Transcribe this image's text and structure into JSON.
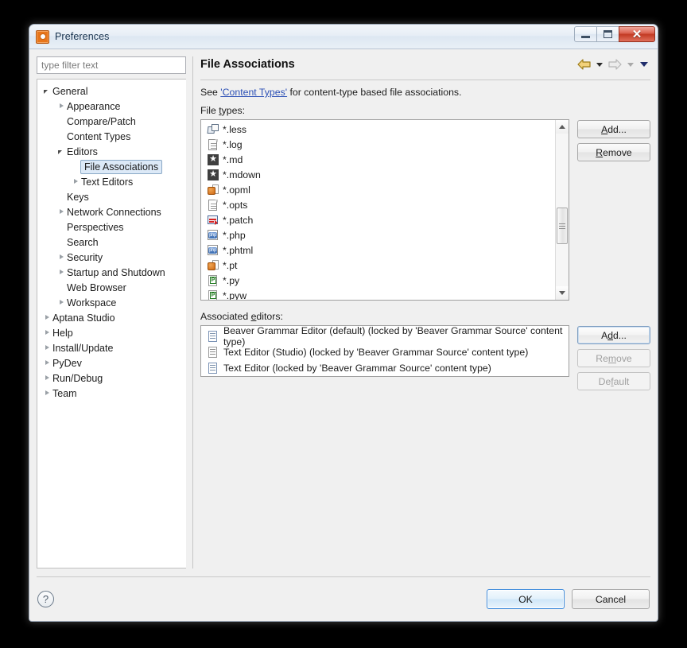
{
  "window": {
    "title": "Preferences",
    "icon": "gear-icon",
    "controls": {
      "minimize": "minimize-button",
      "maximize": "maximize-button",
      "close": "✕"
    }
  },
  "sidebar": {
    "filter": {
      "placeholder": "type filter text",
      "value": ""
    },
    "items": [
      {
        "label": "General",
        "indent": 0,
        "arrow": "expanded",
        "selected": false
      },
      {
        "label": "Appearance",
        "indent": 1,
        "arrow": "collapsed",
        "selected": false
      },
      {
        "label": "Compare/Patch",
        "indent": 1,
        "arrow": "none",
        "selected": false
      },
      {
        "label": "Content Types",
        "indent": 1,
        "arrow": "none",
        "selected": false
      },
      {
        "label": "Editors",
        "indent": 1,
        "arrow": "expanded",
        "selected": false
      },
      {
        "label": "File Associations",
        "indent": 2,
        "arrow": "none",
        "selected": true
      },
      {
        "label": "Text Editors",
        "indent": 2,
        "arrow": "collapsed",
        "selected": false
      },
      {
        "label": "Keys",
        "indent": 1,
        "arrow": "none",
        "selected": false
      },
      {
        "label": "Network Connections",
        "indent": 1,
        "arrow": "collapsed",
        "selected": false
      },
      {
        "label": "Perspectives",
        "indent": 1,
        "arrow": "none",
        "selected": false
      },
      {
        "label": "Search",
        "indent": 1,
        "arrow": "none",
        "selected": false
      },
      {
        "label": "Security",
        "indent": 1,
        "arrow": "collapsed",
        "selected": false
      },
      {
        "label": "Startup and Shutdown",
        "indent": 1,
        "arrow": "collapsed",
        "selected": false
      },
      {
        "label": "Web Browser",
        "indent": 1,
        "arrow": "none",
        "selected": false
      },
      {
        "label": "Workspace",
        "indent": 1,
        "arrow": "collapsed",
        "selected": false
      },
      {
        "label": "Aptana Studio",
        "indent": 0,
        "arrow": "collapsed",
        "selected": false
      },
      {
        "label": "Help",
        "indent": 0,
        "arrow": "collapsed",
        "selected": false
      },
      {
        "label": "Install/Update",
        "indent": 0,
        "arrow": "collapsed",
        "selected": false
      },
      {
        "label": "PyDev",
        "indent": 0,
        "arrow": "collapsed",
        "selected": false
      },
      {
        "label": "Run/Debug",
        "indent": 0,
        "arrow": "collapsed",
        "selected": false
      },
      {
        "label": "Team",
        "indent": 0,
        "arrow": "collapsed",
        "selected": false
      }
    ]
  },
  "page": {
    "title": "File Associations",
    "nav": {
      "back_icon": "back-arrow-icon",
      "back_menu_icon": "chevron-down-icon",
      "forward_icon": "forward-arrow-icon",
      "forward_menu_icon": "chevron-down-icon",
      "menu_icon": "chevron-down-icon"
    },
    "hint_prefix": "See ",
    "hint_link": "'Content Types'",
    "hint_suffix": " for content-type based file associations.",
    "file_types_label": "File types:",
    "associated_editors_label": "Associated editors:"
  },
  "file_types": {
    "items": [
      {
        "name": "*.less",
        "icon": "less-file-icon"
      },
      {
        "name": "*.log",
        "icon": "text-file-icon"
      },
      {
        "name": "*.md",
        "icon": "markdown-star-icon"
      },
      {
        "name": "*.mdown",
        "icon": "markdown-star-icon"
      },
      {
        "name": "*.opml",
        "icon": "opml-file-icon"
      },
      {
        "name": "*.opts",
        "icon": "text-file-icon"
      },
      {
        "name": "*.patch",
        "icon": "patch-file-icon"
      },
      {
        "name": "*.php",
        "icon": "php-file-icon"
      },
      {
        "name": "*.phtml",
        "icon": "php-file-icon"
      },
      {
        "name": "*.pt",
        "icon": "opml-file-icon"
      },
      {
        "name": "*.py",
        "icon": "python-file-icon"
      },
      {
        "name": "*.pyw",
        "icon": "python-file-icon"
      }
    ],
    "buttons": {
      "add": "Add...",
      "add_mnemonic": "A",
      "remove": "Remove",
      "remove_mnemonic": "R"
    }
  },
  "associated_editors": {
    "items": [
      {
        "label": "Beaver Grammar Editor (default) (locked by 'Beaver Grammar Source' content type)",
        "icon": "editor-file-icon-blue"
      },
      {
        "label": "Text Editor (Studio) (locked by 'Beaver Grammar Source' content type)",
        "icon": "editor-file-icon-grey"
      },
      {
        "label": "Text Editor (locked by 'Beaver Grammar Source' content type)",
        "icon": "editor-file-icon-blue"
      }
    ],
    "buttons": {
      "add": "Add...",
      "add_mnemonic": "d",
      "remove": "Remove",
      "remove_mnemonic": "m",
      "default": "Default",
      "default_mnemonic": "f"
    }
  },
  "footer": {
    "help_icon": "?",
    "ok": "OK",
    "cancel": "Cancel"
  }
}
